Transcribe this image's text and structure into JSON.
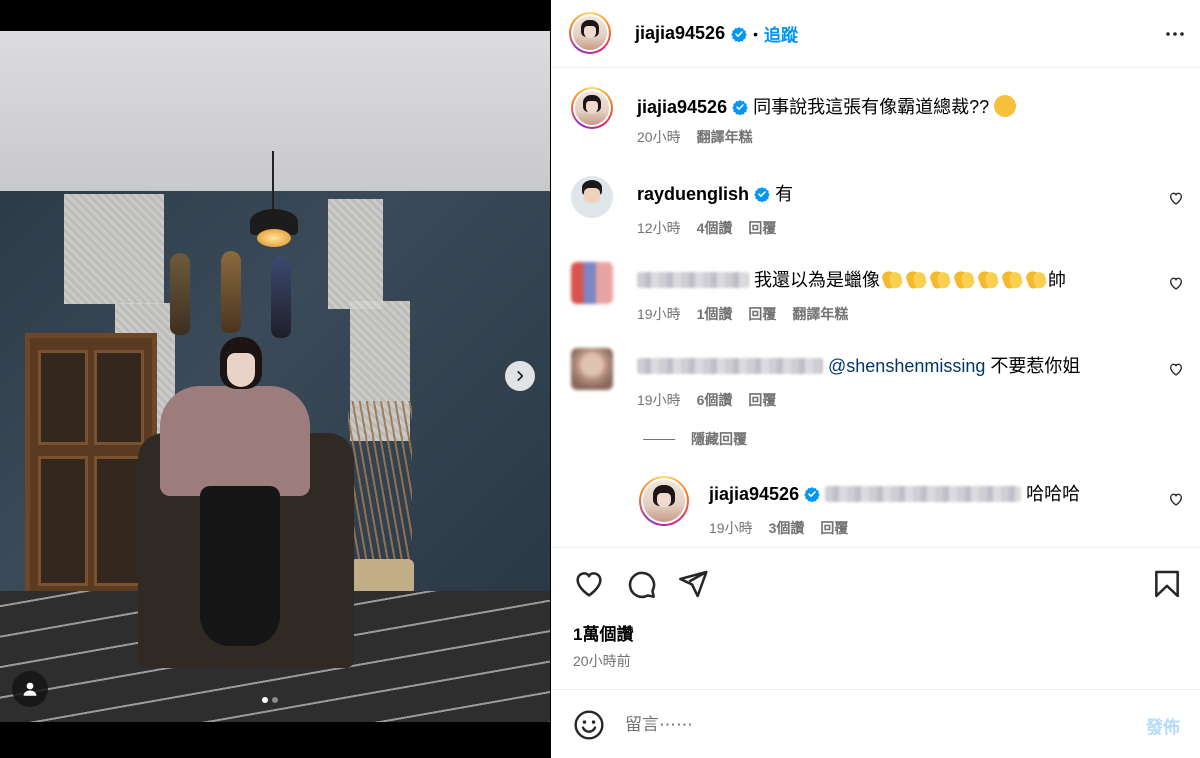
{
  "post": {
    "author": "jiajia94526",
    "follow_label": "追蹤",
    "separator": "•",
    "caption": "同事說我這張有像霸道總裁??",
    "caption_time": "20小時",
    "caption_translate": "翻譯年糕",
    "likes": "1萬個讚",
    "posted_ago": "20小時前",
    "image_count": 2,
    "current_image": 1
  },
  "comments": [
    {
      "username": "rayduenglish",
      "verified": true,
      "text": "有",
      "time": "12小時",
      "likes": "4個讚",
      "reply": "回覆"
    },
    {
      "username_blurred": true,
      "text_prefix": "我還以為是蠟像",
      "clap_count": 7,
      "text_suffix": "帥",
      "time": "19小時",
      "likes": "1個讚",
      "reply": "回覆",
      "translate": "翻譯年糕"
    },
    {
      "username_blurred": true,
      "mention": "@shenshenmissing",
      "text": "不要惹你姐",
      "time": "19小時",
      "likes": "6個讚",
      "reply": "回覆"
    }
  ],
  "hide_replies_label": "隱藏回覆",
  "reply": {
    "username": "jiajia94526",
    "verified": true,
    "mention_blurred": true,
    "text": "哈哈哈",
    "time": "19小時",
    "likes": "3個讚",
    "reply": "回覆"
  },
  "composer": {
    "placeholder": "留言⋯⋯",
    "post_label": "發佈"
  },
  "colors": {
    "accent": "#0095f6",
    "muted": "#737373",
    "post_disabled": "#b3dbff"
  }
}
